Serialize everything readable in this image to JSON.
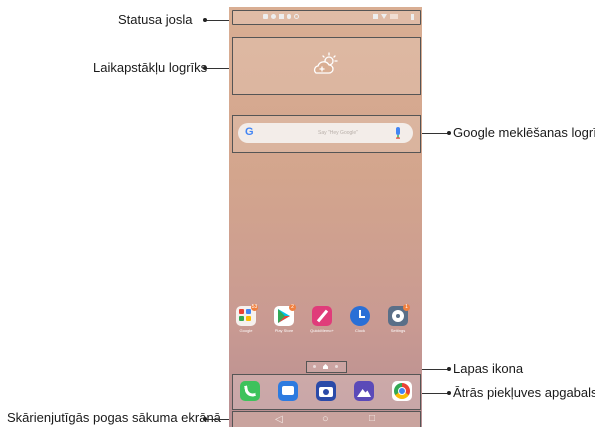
{
  "labels": {
    "status_bar": "Statusa josla",
    "weather_widget": "Laikapstākļu logrīks",
    "google_search": "Google meklēšanas logrīks",
    "page_icon": "Lapas ikona",
    "quick_access": "Ātrās piekļuves apgabals",
    "touch_buttons": "Skārienjutīgās pogas sākuma ekrānā"
  },
  "search": {
    "logo": "G",
    "placeholder": "Say \"Hey Google\""
  },
  "apps": [
    {
      "name": "Google",
      "icon": "folder-icon",
      "color": "#ffffff",
      "badge": "53"
    },
    {
      "name": "Play Store",
      "icon": "play-store-icon",
      "color": "#ffffff",
      "badge": "2"
    },
    {
      "name": "QuickMemo+",
      "icon": "memo-icon",
      "color": "#e03c7a",
      "badge": ""
    },
    {
      "name": "Clock",
      "icon": "clock-icon",
      "color": "#2a6fd6",
      "badge": ""
    },
    {
      "name": "Settings",
      "icon": "settings-icon",
      "color": "#5a6f88",
      "badge": "1"
    }
  ],
  "dock": [
    {
      "icon": "phone-icon",
      "color": "#3ec25c"
    },
    {
      "icon": "messages-icon",
      "color": "#2d7be0"
    },
    {
      "icon": "camera-icon",
      "color": "#2a4aa8"
    },
    {
      "icon": "gallery-icon",
      "color": "#5b4ab8"
    },
    {
      "icon": "chrome-icon",
      "color": "#ffffff"
    }
  ],
  "nav": {
    "back": "◁",
    "home": "○",
    "recents": "□"
  }
}
